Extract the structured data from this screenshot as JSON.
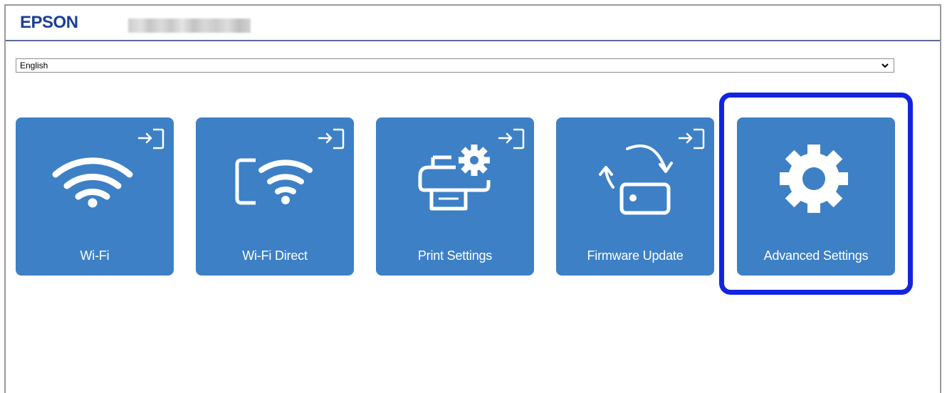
{
  "header": {
    "brand": "EPSON"
  },
  "language_select": {
    "selected": "English"
  },
  "tiles": [
    {
      "label": "Wi-Fi",
      "icon": "wifi-icon",
      "login_icon": "login-icon"
    },
    {
      "label": "Wi-Fi Direct",
      "icon": "wifi-direct-icon",
      "login_icon": "login-icon"
    },
    {
      "label": "Print Settings",
      "icon": "print-settings-icon",
      "login_icon": "login-icon"
    },
    {
      "label": "Firmware Update",
      "icon": "firmware-update-icon",
      "login_icon": "login-icon"
    },
    {
      "label": "Advanced Settings",
      "icon": "gear-icon"
    }
  ],
  "colors": {
    "brand": "#1b3f95",
    "tile": "#3d80c5",
    "highlight": "#1324e0",
    "header_rule": "#5b6a92"
  }
}
